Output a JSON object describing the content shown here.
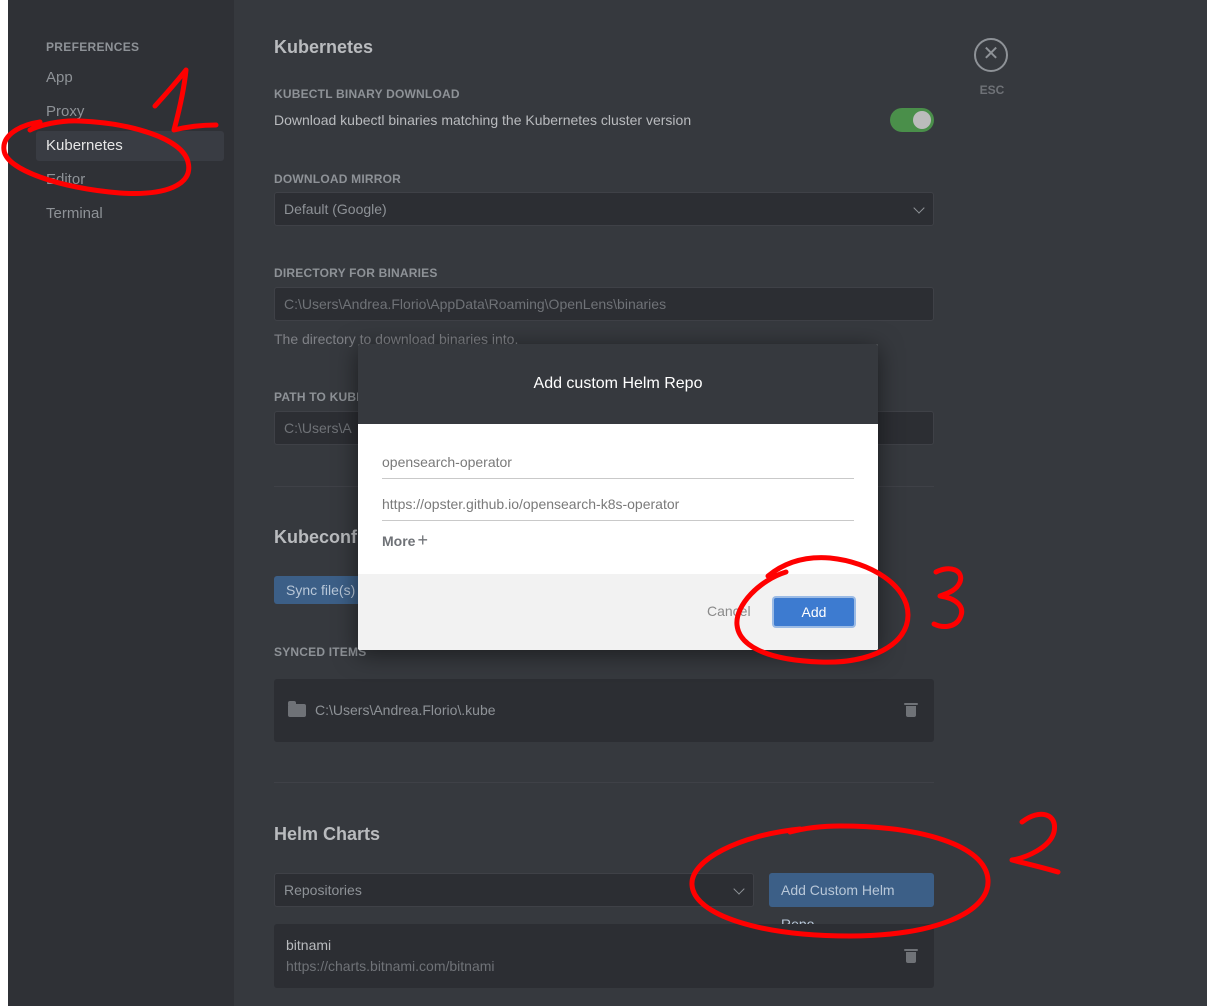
{
  "sidebar": {
    "heading": "PREFERENCES",
    "items": [
      {
        "label": "App"
      },
      {
        "label": "Proxy"
      },
      {
        "label": "Kubernetes"
      },
      {
        "label": "Editor"
      },
      {
        "label": "Terminal"
      }
    ],
    "active_item": "Kubernetes"
  },
  "close": {
    "glyph": "✕",
    "label": "ESC"
  },
  "kubernetes": {
    "title": "Kubernetes",
    "kubectl_download": {
      "label": "KUBECTL BINARY DOWNLOAD",
      "description": "Download kubectl binaries matching the Kubernetes cluster version",
      "enabled": true
    },
    "download_mirror": {
      "label": "DOWNLOAD MIRROR",
      "value": "Default (Google)"
    },
    "directory_for_binaries": {
      "label": "DIRECTORY FOR BINARIES",
      "placeholder": "C:\\Users\\Andrea.Florio\\AppData\\Roaming\\OpenLens\\binaries",
      "hint": "The directory to download binaries into."
    },
    "path_to_kubectl": {
      "label": "PATH TO KUBE",
      "placeholder": "C:\\Users\\A"
    }
  },
  "kubeconfig": {
    "title": "Kubeconfig",
    "sync_button": "Sync file(s)",
    "synced_items_label": "SYNCED ITEMS",
    "synced_items": [
      {
        "path": "C:\\Users\\Andrea.Florio\\.kube"
      }
    ]
  },
  "helm": {
    "title": "Helm Charts",
    "repositories_select": "Repositories",
    "add_custom_button": "Add Custom Helm Repo",
    "repos": [
      {
        "name": "bitnami",
        "url": "https://charts.bitnami.com/bitnami"
      }
    ]
  },
  "modal": {
    "title": "Add custom Helm Repo",
    "name_value": "opensearch-operator",
    "url_value": "https://opster.github.io/opensearch-k8s-operator",
    "more_label": "More",
    "more_glyph": "+",
    "cancel_label": "Cancel",
    "add_label": "Add"
  },
  "colors": {
    "annotation": "#ff0000",
    "toggle_on": "#4a8f4a",
    "primary_button": "#3d7bd0"
  }
}
